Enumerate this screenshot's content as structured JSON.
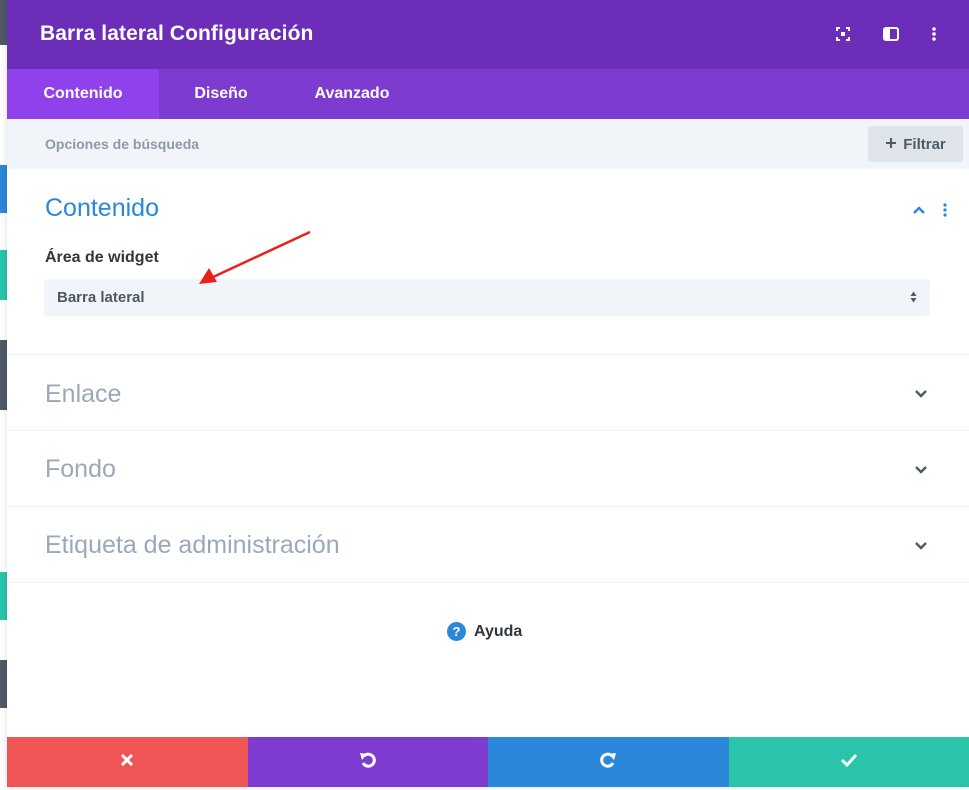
{
  "header": {
    "title": "Barra lateral Configuración",
    "icons": [
      "fullscreen-icon",
      "split-view-icon",
      "kebab-menu-icon"
    ]
  },
  "tabs": [
    {
      "label": "Contenido",
      "active": true
    },
    {
      "label": "Diseño",
      "active": false
    },
    {
      "label": "Avanzado",
      "active": false
    }
  ],
  "search": {
    "placeholder": "Opciones de búsqueda",
    "filter_label": "Filtrar"
  },
  "sections": {
    "content": {
      "title": "Contenido",
      "expanded": true,
      "field_label": "Área de widget",
      "select_value": "Barra lateral"
    },
    "link": {
      "title": "Enlace",
      "expanded": false
    },
    "background": {
      "title": "Fondo",
      "expanded": false
    },
    "admin_label": {
      "title": "Etiqueta de administración",
      "expanded": false
    }
  },
  "help": {
    "label": "Ayuda"
  },
  "footer": {
    "buttons": [
      {
        "name": "cancel",
        "icon": "close-icon",
        "color": "#ef5555"
      },
      {
        "name": "undo",
        "icon": "undo-icon",
        "color": "#7e3bd0"
      },
      {
        "name": "redo",
        "icon": "redo-icon",
        "color": "#2b87da"
      },
      {
        "name": "save",
        "icon": "check-icon",
        "color": "#29c4a9"
      }
    ]
  },
  "colors": {
    "header": "#6c2eb9",
    "tabs": "#7e3bd0",
    "active_tab": "#8f42ec",
    "accent_blue": "#2b87da",
    "annotation_arrow": "#e8201e"
  }
}
